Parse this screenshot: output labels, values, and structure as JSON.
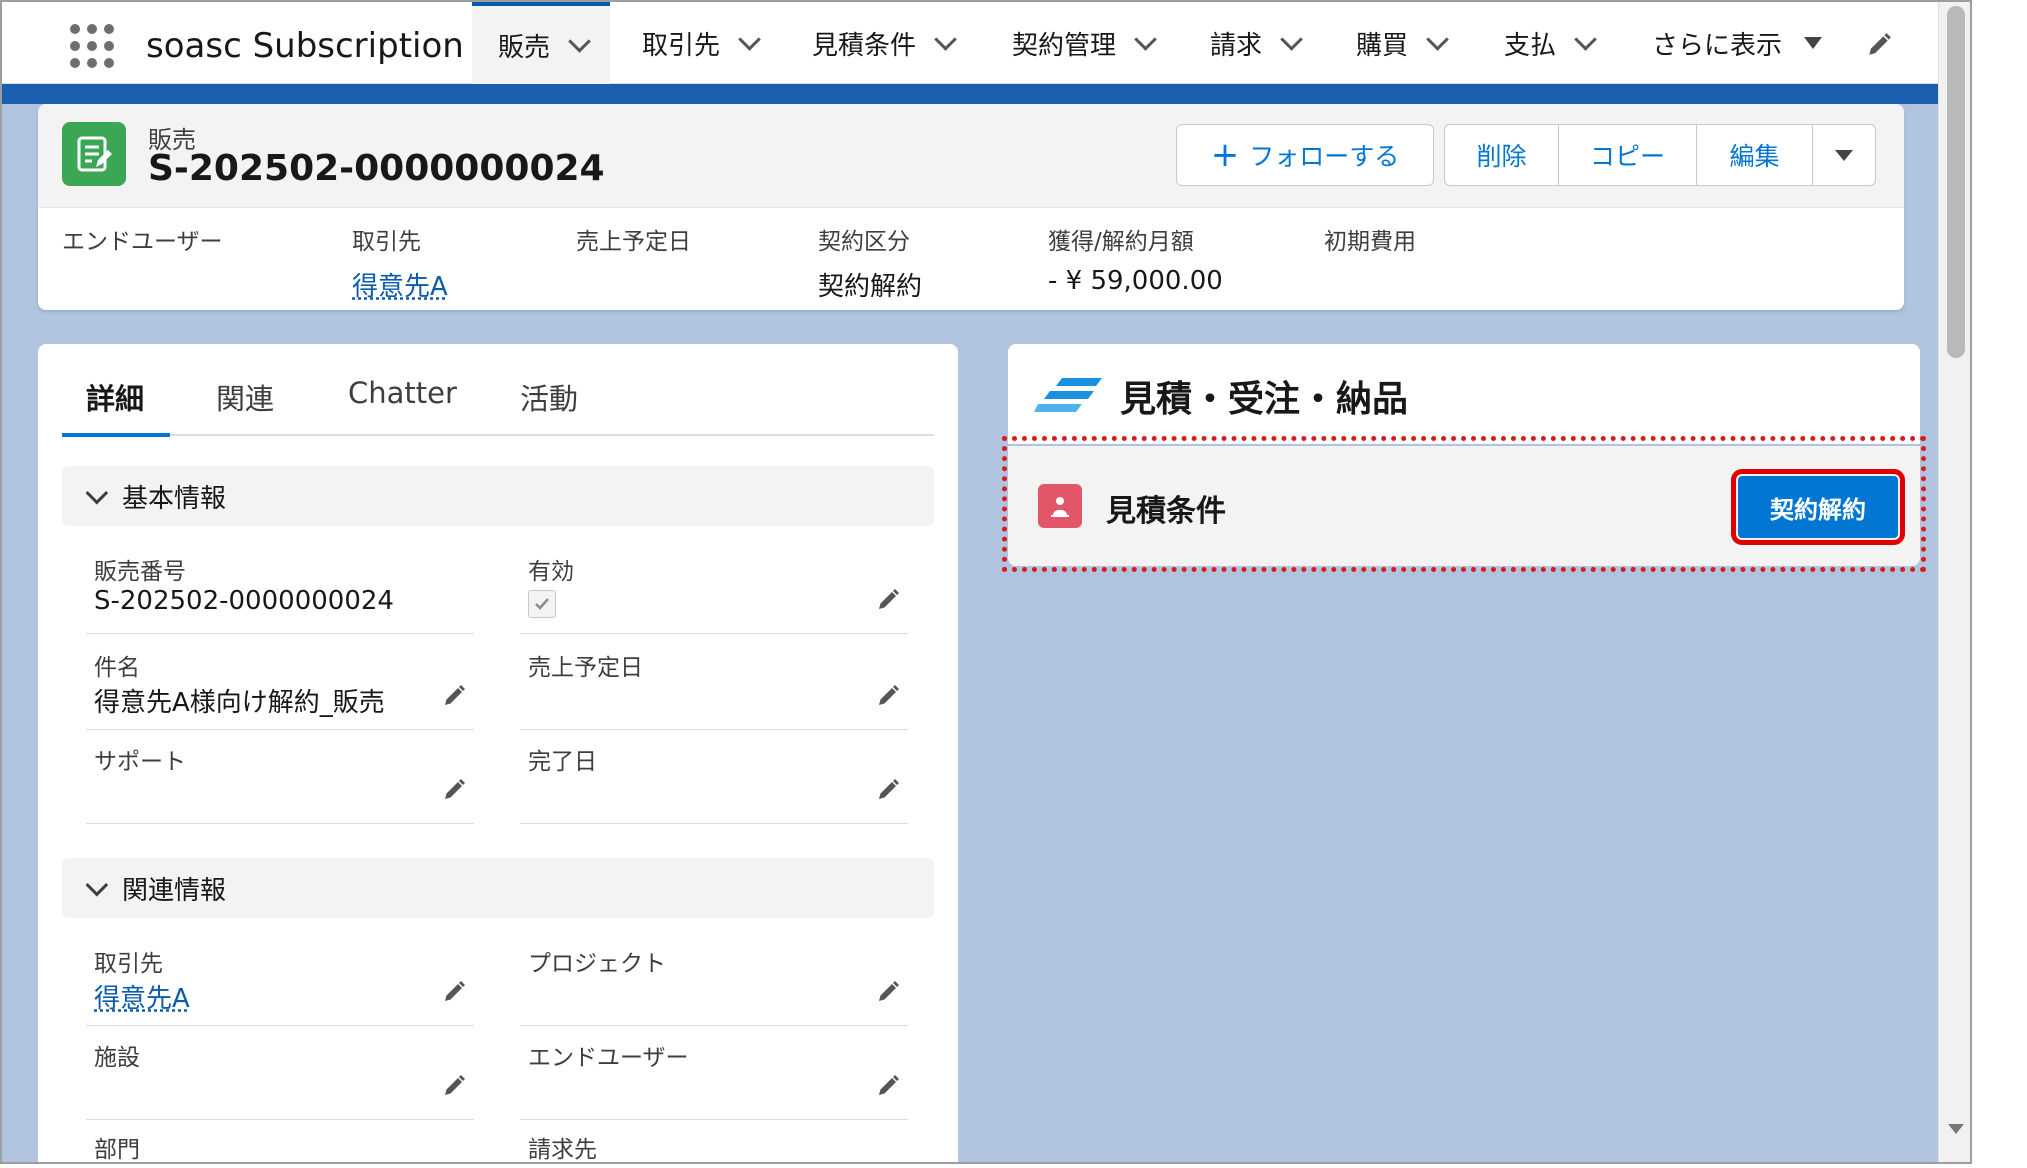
{
  "app": {
    "name": "soasc Subscription"
  },
  "nav": {
    "items": [
      {
        "label": "販売",
        "active": true
      },
      {
        "label": "取引先"
      },
      {
        "label": "見積条件"
      },
      {
        "label": "契約管理"
      },
      {
        "label": "請求"
      },
      {
        "label": "購買"
      },
      {
        "label": "支払"
      }
    ],
    "more_label": "さらに表示"
  },
  "record": {
    "type_label": "販売",
    "name": "S-202502-0000000024",
    "actions": {
      "follow": "フォローする",
      "delete": "削除",
      "copy": "コピー",
      "edit": "編集"
    },
    "highlights": [
      {
        "label": "エンドユーザー",
        "value": ""
      },
      {
        "label": "取引先",
        "value": "得意先A",
        "link": true
      },
      {
        "label": "売上予定日",
        "value": ""
      },
      {
        "label": "契約区分",
        "value": "契約解約"
      },
      {
        "label": "獲得/解約月額",
        "value": "- ¥ 59,000.00"
      },
      {
        "label": "初期費用",
        "value": ""
      }
    ]
  },
  "detail": {
    "tabs": [
      "詳細",
      "関連",
      "Chatter",
      "活動"
    ],
    "active_tab": "詳細",
    "sections": {
      "basic": {
        "title": "基本情報",
        "fields": {
          "sales_number": {
            "label": "販売番号",
            "value": "S-202502-0000000024"
          },
          "valid": {
            "label": "有効",
            "checked": true
          },
          "subject": {
            "label": "件名",
            "value": "得意先A様向け解約_販売"
          },
          "sales_date": {
            "label": "売上予定日",
            "value": ""
          },
          "support": {
            "label": "サポート",
            "value": ""
          },
          "complete_date": {
            "label": "完了日",
            "value": ""
          }
        }
      },
      "related": {
        "title": "関連情報",
        "fields": {
          "account": {
            "label": "取引先",
            "value": "得意先A"
          },
          "project": {
            "label": "プロジェクト",
            "value": ""
          },
          "facility": {
            "label": "施設",
            "value": ""
          },
          "end_user": {
            "label": "エンドユーザー",
            "value": ""
          },
          "department": {
            "label": "部門",
            "value": ""
          },
          "bill_to": {
            "label": "請求先",
            "value": ""
          }
        }
      }
    }
  },
  "quote_panel": {
    "title": "見積・受注・納品",
    "row_title": "見積条件",
    "button": "契約解約"
  },
  "colors": {
    "brand_blue": "#0176d3",
    "highlight_red": "#e00000",
    "record_icon_green": "#3ba755",
    "quote_icon_pink": "#e3566a"
  }
}
